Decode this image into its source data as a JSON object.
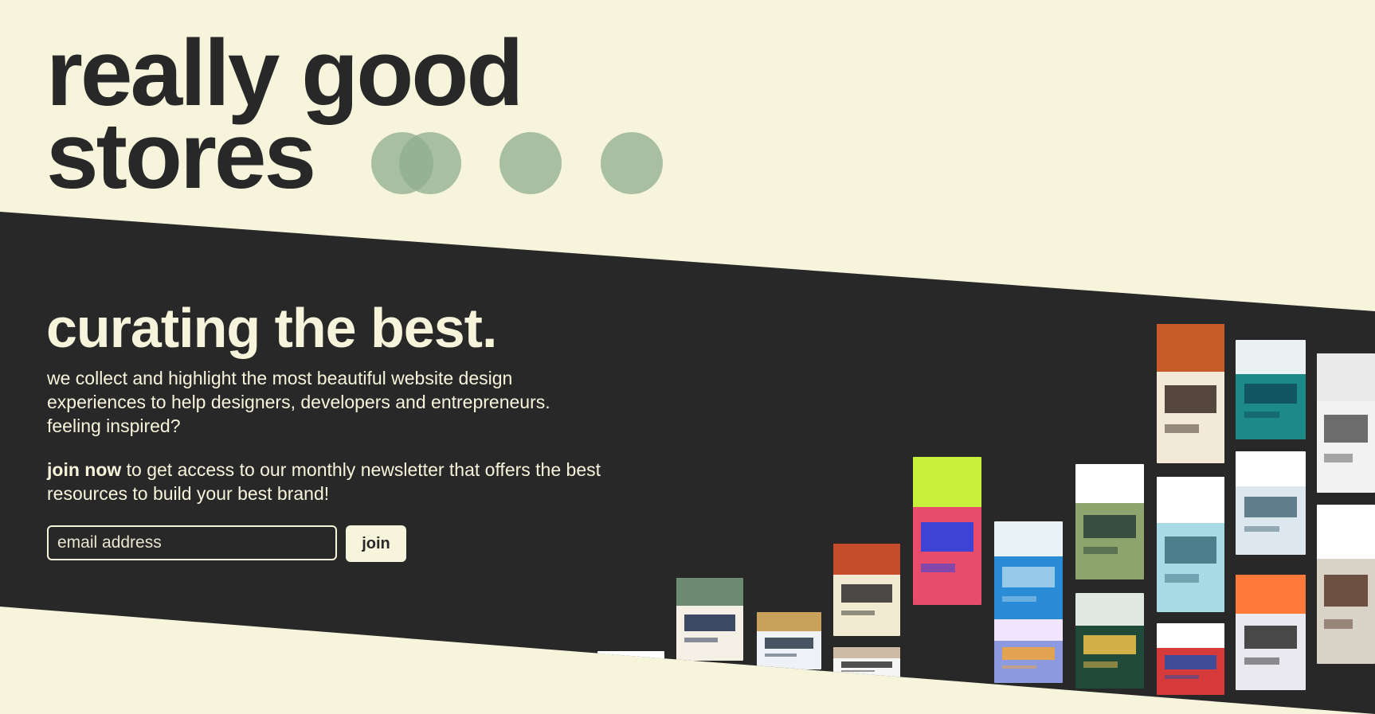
{
  "logo": {
    "line1": "really good",
    "line2": "stores"
  },
  "hero": {
    "headline": "curating the best.",
    "description": "we collect and highlight the most beautiful website design experiences to help designers, developers and entrepreneurs. feeling inspired?",
    "join_bold": "join now",
    "join_rest": " to get access to our monthly newsletter that offers the best resources to build your best brand!"
  },
  "signup": {
    "placeholder": "email address",
    "button_label": "join"
  },
  "gallery": {
    "items": [
      {
        "name": "store-screenshot-1",
        "colors": [
          "#f4f0e6",
          "#6d8a73",
          "#1c2c4a"
        ]
      },
      {
        "name": "store-screenshot-2",
        "colors": [
          "#eef2f7",
          "#c8a25b",
          "#2c3a4a"
        ]
      },
      {
        "name": "store-screenshot-3",
        "colors": [
          "#f3ead2",
          "#c44b2c",
          "#2b2b2b"
        ]
      },
      {
        "name": "store-screenshot-4",
        "colors": [
          "#e94b6a",
          "#c6f03a",
          "#2142e8"
        ]
      },
      {
        "name": "store-screenshot-5",
        "colors": [
          "#f5f5f5",
          "#cdbba6",
          "#333333"
        ]
      },
      {
        "name": "store-screenshot-6",
        "colors": [
          "#2a8bd6",
          "#e9f2f7",
          "#a9d4ea"
        ]
      },
      {
        "name": "store-screenshot-7",
        "colors": [
          "#8da46c",
          "#ffffff",
          "#294036"
        ]
      },
      {
        "name": "store-screenshot-8",
        "colors": [
          "#8e9adf",
          "#f2e5ff",
          "#f0a53a"
        ]
      },
      {
        "name": "store-screenshot-9",
        "colors": [
          "#f2ead6",
          "#c85b2a",
          "#3a2a22"
        ]
      },
      {
        "name": "store-screenshot-10",
        "colors": [
          "#a8dbe6",
          "#ffffff",
          "#3a6e7a"
        ]
      },
      {
        "name": "store-screenshot-11",
        "colors": [
          "#d63a3a",
          "#ffffff",
          "#2450a8"
        ]
      },
      {
        "name": "store-screenshot-12",
        "colors": [
          "#1c8a86",
          "#e9f1f2",
          "#0f4c5c"
        ]
      },
      {
        "name": "store-screenshot-13",
        "colors": [
          "#dde7ef",
          "#ffffff",
          "#4a6b7a"
        ]
      },
      {
        "name": "store-screenshot-14",
        "colors": [
          "#e9e9ef",
          "#ff7a3a",
          "#2c2c2c"
        ]
      },
      {
        "name": "store-screenshot-15",
        "colors": [
          "#1f4a3a",
          "#dfe9e2",
          "#f2c14a"
        ]
      },
      {
        "name": "store-screenshot-16",
        "colors": [
          "#f2f2f2",
          "#eaeaea",
          "#555555"
        ]
      },
      {
        "name": "store-screenshot-17",
        "colors": [
          "#d9d2c6",
          "#ffffff",
          "#5a3a2a"
        ]
      },
      {
        "name": "store-screenshot-18",
        "colors": [
          "#7da7c8",
          "#ffffff",
          "#2c4a6b"
        ]
      }
    ]
  },
  "colors": {
    "background": "#f7f4dc",
    "band": "#282828",
    "text_dark": "#282828",
    "text_light": "#f7f4dc",
    "dot": "#8fae8e"
  }
}
